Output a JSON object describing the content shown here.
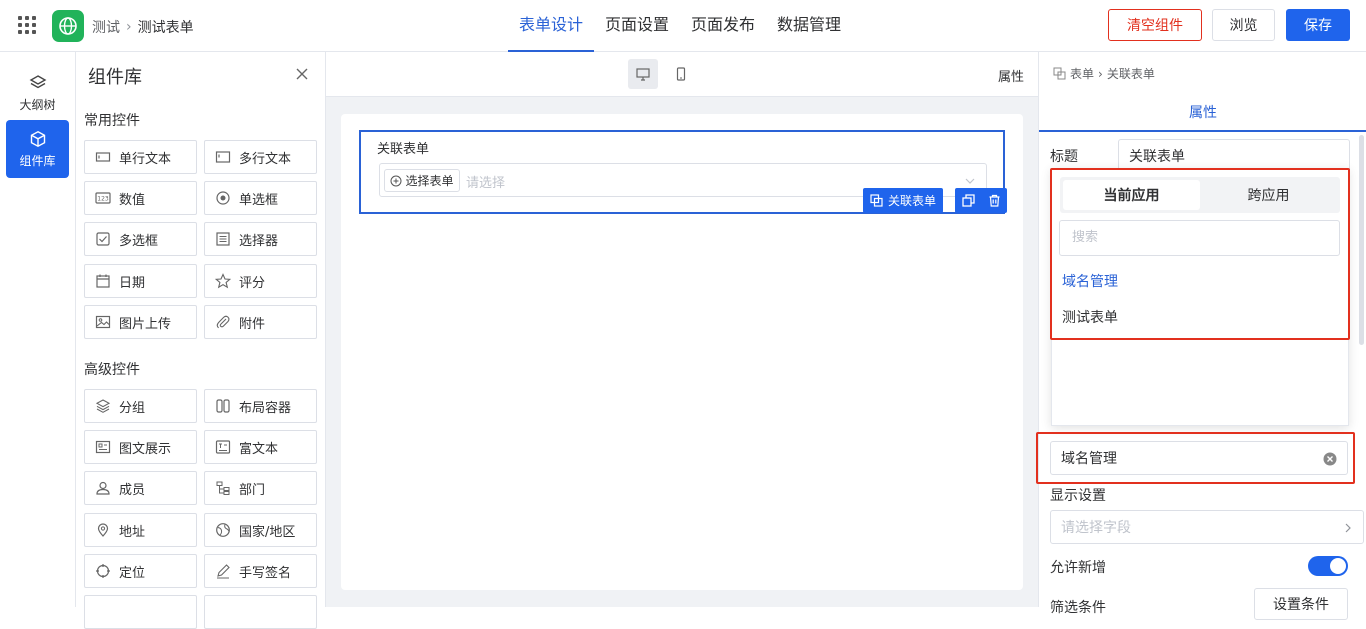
{
  "header": {
    "breadcrumb": [
      "测试",
      "测试表单"
    ],
    "tabs": [
      "表单设计",
      "页面设置",
      "页面发布",
      "数据管理"
    ],
    "active_tab": 0,
    "clear_label": "清空组件",
    "preview_label": "浏览",
    "save_label": "保存"
  },
  "rail": {
    "items": [
      {
        "label": "大纲树",
        "icon": "layers-icon"
      },
      {
        "label": "组件库",
        "icon": "cube-icon"
      }
    ]
  },
  "complib": {
    "title": "组件库",
    "common_title": "常用控件",
    "common": [
      {
        "label": "单行文本",
        "icon": "single-line-text-icon"
      },
      {
        "label": "多行文本",
        "icon": "multi-line-text-icon"
      },
      {
        "label": "数值",
        "icon": "number-icon"
      },
      {
        "label": "单选框",
        "icon": "radio-icon"
      },
      {
        "label": "多选框",
        "icon": "checkbox-icon"
      },
      {
        "label": "选择器",
        "icon": "select-icon"
      },
      {
        "label": "日期",
        "icon": "calendar-icon"
      },
      {
        "label": "评分",
        "icon": "star-icon"
      },
      {
        "label": "图片上传",
        "icon": "image-icon"
      },
      {
        "label": "附件",
        "icon": "paperclip-icon"
      }
    ],
    "advanced_title": "高级控件",
    "advanced": [
      {
        "label": "分组",
        "icon": "layers-icon"
      },
      {
        "label": "布局容器",
        "icon": "columns-icon"
      },
      {
        "label": "图文展示",
        "icon": "card-icon"
      },
      {
        "label": "富文本",
        "icon": "rich-text-icon"
      },
      {
        "label": "成员",
        "icon": "user-icon"
      },
      {
        "label": "部门",
        "icon": "org-icon"
      },
      {
        "label": "地址",
        "icon": "map-pin-icon"
      },
      {
        "label": "国家/地区",
        "icon": "globe-icon"
      },
      {
        "label": "定位",
        "icon": "locate-icon"
      },
      {
        "label": "手写签名",
        "icon": "pen-icon"
      }
    ]
  },
  "canvas": {
    "prop_label": "属性",
    "field_label": "关联表单",
    "pick_label": "选择表单",
    "placeholder": "请选择",
    "tag_label": "关联表单"
  },
  "panel": {
    "breadcrumb": [
      "表单",
      "关联表单"
    ],
    "tab": "属性",
    "title_label": "标题",
    "title_value": "关联表单",
    "linked_value": "域名管理",
    "display_label": "显示设置",
    "display_placeholder": "请选择字段",
    "allow_add_label": "允许新增",
    "allow_add": true,
    "filter_label": "筛选条件",
    "filter_button": "设置条件"
  },
  "popover": {
    "tabs": [
      "当前应用",
      "跨应用"
    ],
    "active_tab": 0,
    "search_placeholder": "搜索",
    "items": [
      "域名管理",
      "测试表单"
    ],
    "selected": 0
  },
  "colors": {
    "primary": "#1f64ec",
    "danger": "#e2301e",
    "app_logo": "#21b35a"
  }
}
